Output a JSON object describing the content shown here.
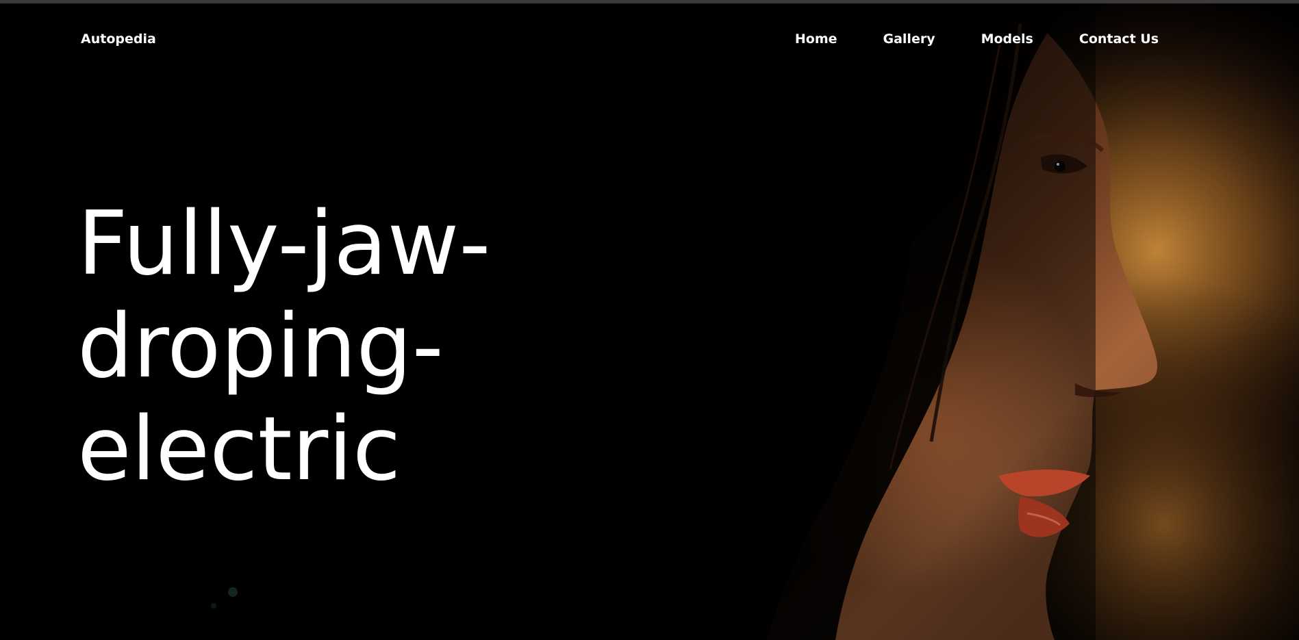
{
  "brand": {
    "name": "Autopedia"
  },
  "nav": {
    "items": [
      {
        "label": "Home"
      },
      {
        "label": "Gallery"
      },
      {
        "label": "Models"
      },
      {
        "label": "Contact Us"
      }
    ]
  },
  "hero": {
    "headline_lines": [
      "Fully-jaw-",
      "droping-",
      "electric"
    ],
    "background": {
      "type": "video-still",
      "description_icon": "portrait-background-image"
    }
  },
  "colors": {
    "background": "#000000",
    "text": "#ffffff",
    "top_strip": "#3a3a3a",
    "warm_glow": "#c98a3a",
    "skin": "#a4633a",
    "lips": "#b8452a"
  }
}
